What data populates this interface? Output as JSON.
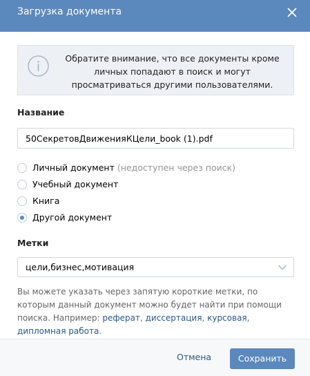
{
  "dialog": {
    "title": "Загрузка документа"
  },
  "notice": {
    "text": "Обратите внимание, что все документы кроме личных попадают в поиск и могут просматриваться другими пользователями."
  },
  "form": {
    "name_label": "Название",
    "name_value": "50СекретовДвиженияКЦели_book (1).pdf",
    "doc_types": [
      {
        "label": "Личный документ",
        "note": "(недоступен через поиск)",
        "checked": false
      },
      {
        "label": "Учебный документ",
        "checked": false
      },
      {
        "label": "Книга",
        "checked": false
      },
      {
        "label": "Другой документ",
        "checked": true
      }
    ],
    "tags_label": "Метки",
    "tags_value": "цели,бизнес,мотивация"
  },
  "hint": {
    "text_before": "Вы можете указать через запятую короткие метки, по которым данный документ можно будет найти при помощи поиска. Например: ",
    "examples": [
      "реферат",
      "диссертация",
      "курсовая",
      "дипломная работа"
    ],
    "separator": ", ",
    "text_after": "."
  },
  "footer": {
    "cancel_label": "Отмена",
    "save_label": "Сохранить"
  },
  "colors": {
    "accent": "#5b88bd",
    "link": "#2a5885",
    "notice_bg": "#edf0f5"
  },
  "icons": {
    "close": "close-icon",
    "info": "info-icon",
    "dropdown": "chevron-down-icon"
  }
}
